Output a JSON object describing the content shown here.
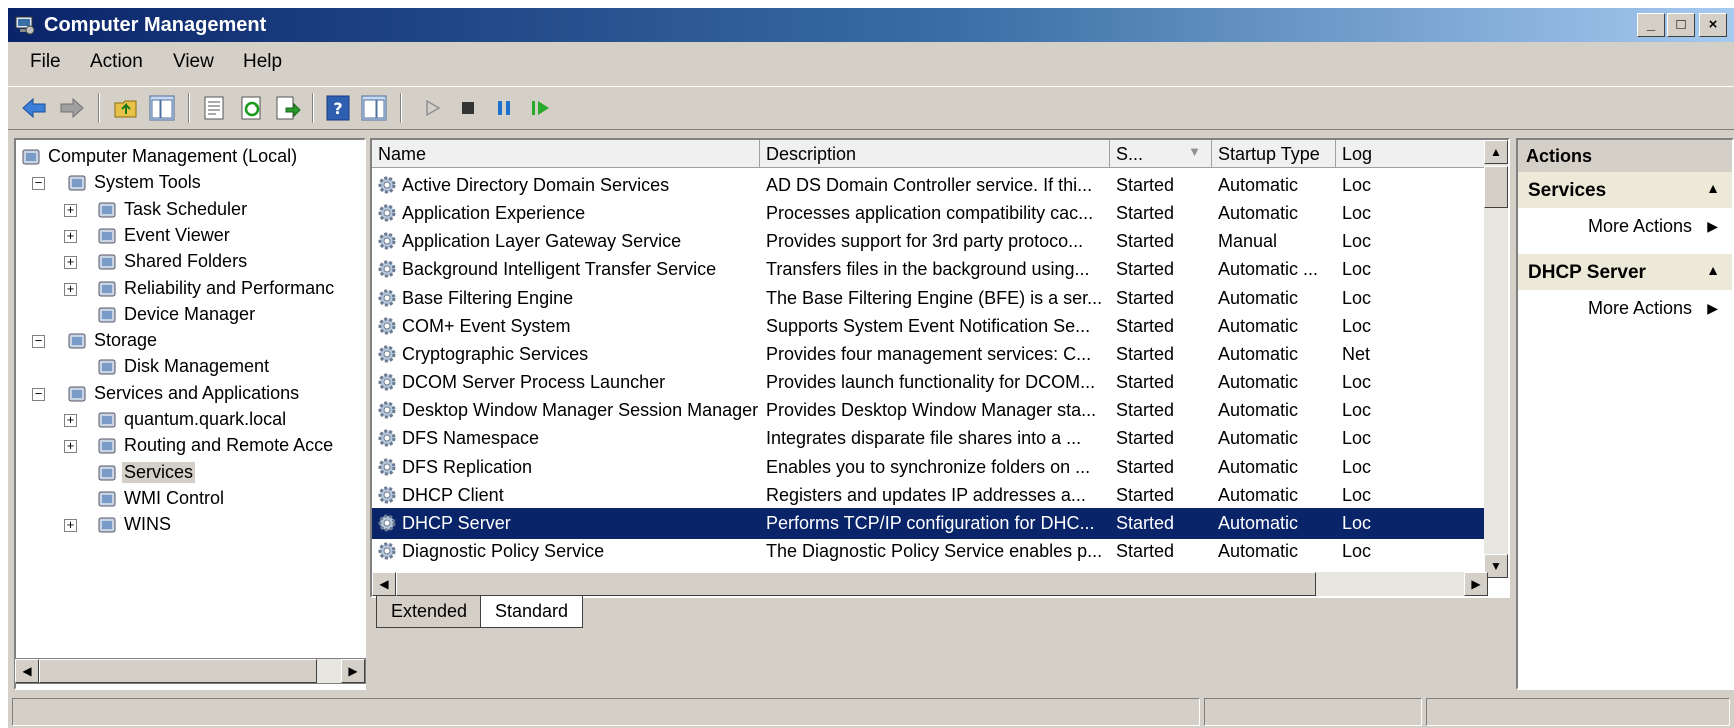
{
  "window": {
    "title": "Computer Management",
    "controls": [
      "_",
      "□",
      "×"
    ]
  },
  "menu": [
    "File",
    "Action",
    "View",
    "Help"
  ],
  "tree": {
    "items": [
      {
        "label": "Computer Management (Local)",
        "icon": "computer-icon",
        "expander": ""
      },
      {
        "label": "System Tools",
        "icon": "tools-icon",
        "expander": "−"
      },
      {
        "label": "Task Scheduler",
        "icon": "clock-icon",
        "expander": "+"
      },
      {
        "label": "Event Viewer",
        "icon": "event-viewer-icon",
        "expander": "+"
      },
      {
        "label": "Shared Folders",
        "icon": "shared-folders-icon",
        "expander": "+"
      },
      {
        "label": "Reliability and Performanc",
        "icon": "performance-icon",
        "expander": "+"
      },
      {
        "label": "Device Manager",
        "icon": "device-manager-icon",
        "expander": ""
      },
      {
        "label": "Storage",
        "icon": "storage-icon",
        "expander": "−"
      },
      {
        "label": "Disk Management",
        "icon": "disk-icon",
        "expander": ""
      },
      {
        "label": "Services and Applications",
        "icon": "services-apps-icon",
        "expander": "−"
      },
      {
        "label": "quantum.quark.local",
        "icon": "dns-icon",
        "expander": "+"
      },
      {
        "label": "Routing and Remote Acce",
        "icon": "routing-icon",
        "expander": "+"
      },
      {
        "label": "Services",
        "icon": "gear-icon",
        "expander": ""
      },
      {
        "label": "WMI Control",
        "icon": "wmi-icon",
        "expander": ""
      },
      {
        "label": "WINS",
        "icon": "server-icon",
        "expander": "+"
      }
    ]
  },
  "list": {
    "columns": [
      "Name",
      "Description",
      "S...",
      "Startup Type",
      "Log"
    ],
    "rows": [
      {
        "name": "Active Directory Domain Services",
        "description": "AD DS Domain Controller service. If thi...",
        "status": "Started",
        "startup": "Automatic",
        "logon": "Loc"
      },
      {
        "name": "Application Experience",
        "description": "Processes application compatibility cac...",
        "status": "Started",
        "startup": "Automatic",
        "logon": "Loc"
      },
      {
        "name": "Application Layer Gateway Service",
        "description": "Provides support for 3rd party protoco...",
        "status": "Started",
        "startup": "Manual",
        "logon": "Loc"
      },
      {
        "name": "Background Intelligent Transfer Service",
        "description": "Transfers files in the background using...",
        "status": "Started",
        "startup": "Automatic ...",
        "logon": "Loc"
      },
      {
        "name": "Base Filtering Engine",
        "description": "The Base Filtering Engine (BFE) is a ser...",
        "status": "Started",
        "startup": "Automatic",
        "logon": "Loc"
      },
      {
        "name": "COM+ Event System",
        "description": "Supports System Event Notification Se...",
        "status": "Started",
        "startup": "Automatic",
        "logon": "Loc"
      },
      {
        "name": "Cryptographic Services",
        "description": "Provides four management services: C...",
        "status": "Started",
        "startup": "Automatic",
        "logon": "Net"
      },
      {
        "name": "DCOM Server Process Launcher",
        "description": "Provides launch functionality for DCOM...",
        "status": "Started",
        "startup": "Automatic",
        "logon": "Loc"
      },
      {
        "name": "Desktop Window Manager Session Manager",
        "description": "Provides Desktop Window Manager sta...",
        "status": "Started",
        "startup": "Automatic",
        "logon": "Loc"
      },
      {
        "name": "DFS Namespace",
        "description": "Integrates disparate file shares into a ...",
        "status": "Started",
        "startup": "Automatic",
        "logon": "Loc"
      },
      {
        "name": "DFS Replication",
        "description": "Enables you to synchronize folders on ...",
        "status": "Started",
        "startup": "Automatic",
        "logon": "Loc"
      },
      {
        "name": "DHCP Client",
        "description": "Registers and updates IP addresses a...",
        "status": "Started",
        "startup": "Automatic",
        "logon": "Loc"
      },
      {
        "name": "DHCP Server",
        "description": "Performs TCP/IP configuration for DHC...",
        "status": "Started",
        "startup": "Automatic",
        "logon": "Loc"
      },
      {
        "name": "Diagnostic Policy Service",
        "description": "The Diagnostic Policy Service enables p...",
        "status": "Started",
        "startup": "Automatic",
        "logon": "Loc"
      }
    ],
    "selected_row": "DHCP Server"
  },
  "tabs": [
    "Extended",
    "Standard"
  ],
  "actions": {
    "header": "Actions",
    "sections": [
      {
        "title": "Services",
        "item": "More Actions"
      },
      {
        "title": "DHCP Server",
        "item": "More Actions"
      }
    ]
  },
  "colors": {
    "selection": "#0a246a",
    "titlebar": "#0a246a",
    "chrome": "#d4d0c8"
  }
}
